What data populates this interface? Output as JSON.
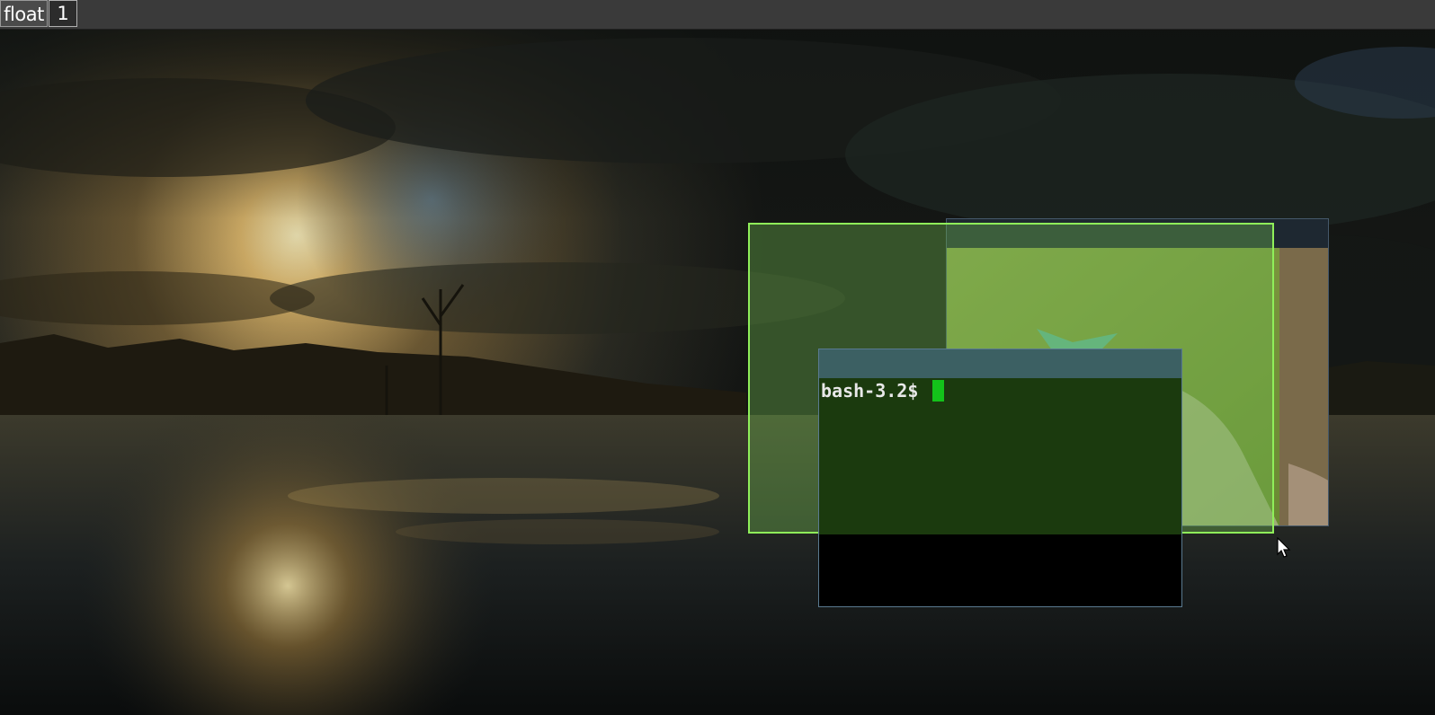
{
  "topbar": {
    "layout_label": "float",
    "tag_label": "1"
  },
  "terminal": {
    "prompt": "bash-3.2$ "
  },
  "icons": {
    "pointer": "mouse-pointer-icon",
    "cursor": "text-cursor"
  },
  "colors": {
    "float_border": "#8fef5a",
    "terminal_bg": "#1b3a0e",
    "cursor": "#13c21a",
    "bar_bg": "#3a3a3a"
  }
}
